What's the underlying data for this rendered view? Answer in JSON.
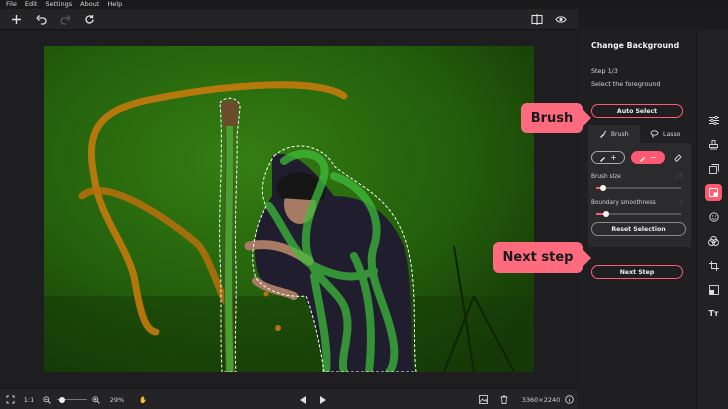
{
  "menu": [
    "File",
    "Edit",
    "Settings",
    "About",
    "Help"
  ],
  "toolbar": {
    "icons": [
      "plus-icon",
      "undo-icon",
      "redo-icon",
      "refresh-icon",
      "compare-icon",
      "eye-icon"
    ]
  },
  "bottom": {
    "ratio": "1:1",
    "zoom": "29%",
    "zoom_level": 0.29,
    "dimensions": "3360×2240"
  },
  "panel": {
    "title": "Change Background",
    "step": "Step 1/3",
    "step_desc": "Select the foreground",
    "auto_select": "Auto Select",
    "tabs": [
      {
        "label": "Brush",
        "icon": "brush-icon",
        "active": true
      },
      {
        "label": "Lasso",
        "icon": "lasso-icon",
        "active": false
      }
    ],
    "brush_size_label": "Brush size",
    "brush_size_value": "25",
    "brush_size_fraction": 0.08,
    "boundary_label": "Boundary smoothness",
    "boundary_value": "1",
    "boundary_fraction": 0.12,
    "reset": "Reset Selection",
    "next": "Next Step"
  },
  "callouts": {
    "brush": "Brush",
    "next": "Next step"
  },
  "rail": [
    "sliders-icon",
    "stamp-icon",
    "layers-icon",
    "background-icon",
    "face-icon",
    "color-circles-icon",
    "crop-icon",
    "resize-icon",
    "text-icon"
  ],
  "colors": {
    "accent": "#ff5a72",
    "callout": "#ff6b7e",
    "panel_bg": "#1f1f21",
    "mask_green": "#3fbf3a",
    "stroke_orange": "#c47a0c"
  }
}
